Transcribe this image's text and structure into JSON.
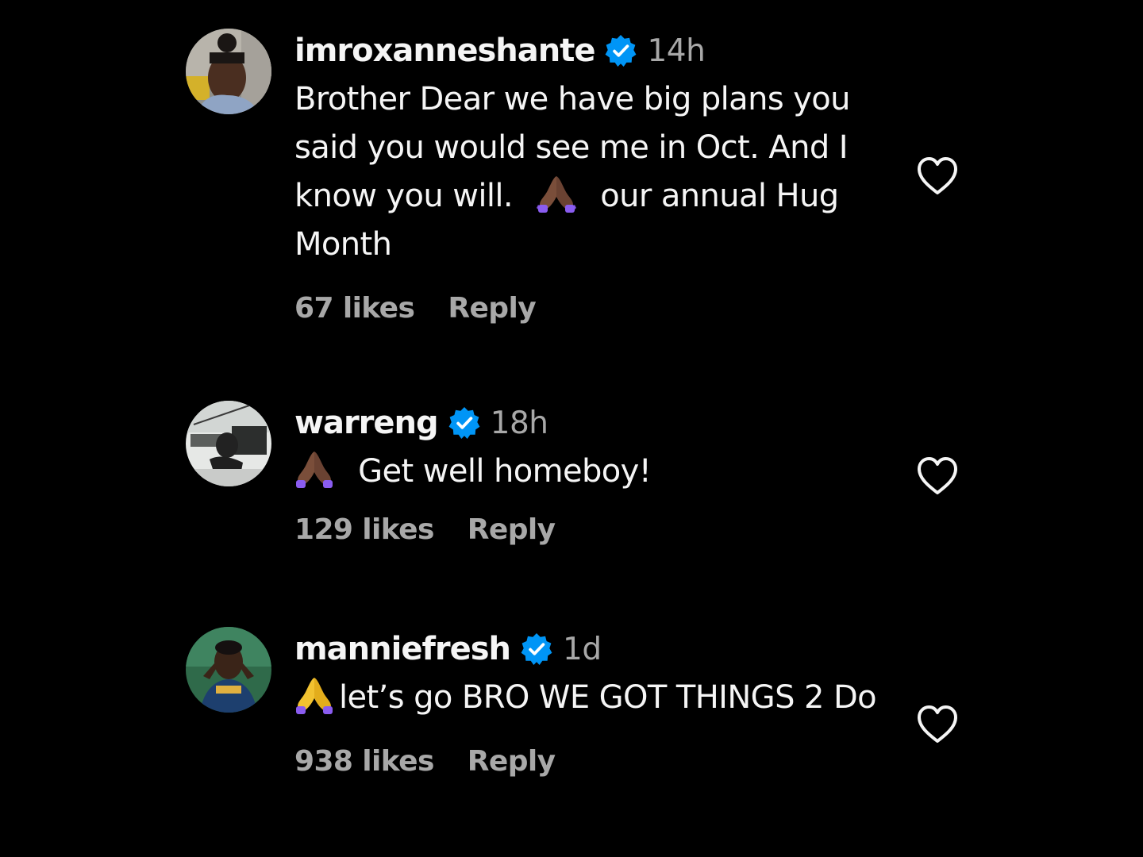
{
  "colors": {
    "background": "#000000",
    "text_primary": "#f5f5f5",
    "text_secondary": "#a8a8a8",
    "verified_badge": "#0095f6"
  },
  "comments": [
    {
      "username": "imroxanneshante",
      "verified_icon": "verified-badge-icon",
      "time": "14h",
      "text_part1": "Brother Dear we have big plans you said you would see me in Oct. And I know you will.",
      "emoji": "folded-hands-medium-dark-skin-tone",
      "text_part2": "our annual Hug Month",
      "likes": "67 likes",
      "reply_label": "Reply",
      "like_icon": "heart-outline-icon"
    },
    {
      "username": "warreng",
      "verified_icon": "verified-badge-icon",
      "time": "18h",
      "emoji": "folded-hands-medium-dark-skin-tone",
      "text_part2": "Get well homeboy!",
      "likes": "129 likes",
      "reply_label": "Reply",
      "like_icon": "heart-outline-icon"
    },
    {
      "username": "manniefresh",
      "verified_icon": "verified-badge-icon",
      "time": "1d",
      "emoji": "folded-hands-default",
      "text_part2": "let’s go BRO WE GOT THINGS 2 Do",
      "likes": "938 likes",
      "reply_label": "Reply",
      "like_icon": "heart-outline-icon"
    }
  ]
}
